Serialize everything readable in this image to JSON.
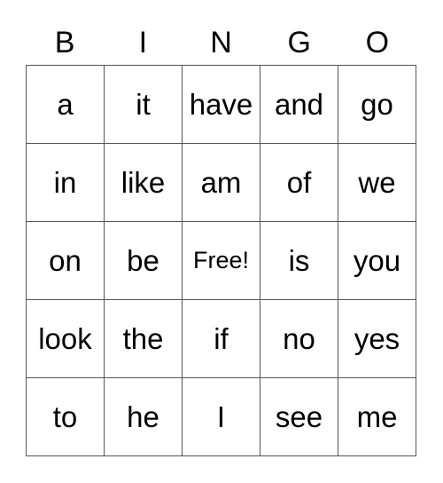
{
  "header": [
    "B",
    "I",
    "N",
    "G",
    "O"
  ],
  "rows": [
    [
      "a",
      "it",
      "have",
      "and",
      "go"
    ],
    [
      "in",
      "like",
      "am",
      "of",
      "we"
    ],
    [
      "on",
      "be",
      "Free!",
      "is",
      "you"
    ],
    [
      "look",
      "the",
      "if",
      "no",
      "yes"
    ],
    [
      "to",
      "he",
      "I",
      "see",
      "me"
    ]
  ]
}
